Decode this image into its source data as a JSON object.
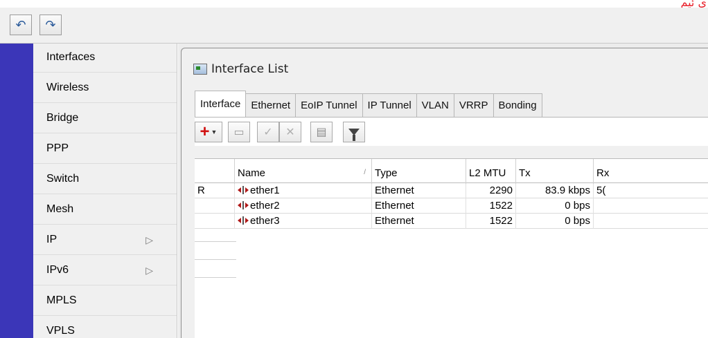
{
  "corner_text": "ى ئيم",
  "toolbar_top": {
    "undo_icon": "undo-icon",
    "redo_icon": "redo-icon"
  },
  "sidebar": {
    "items": [
      {
        "label": "Interfaces",
        "has_submenu": false
      },
      {
        "label": "Wireless",
        "has_submenu": false
      },
      {
        "label": "Bridge",
        "has_submenu": false
      },
      {
        "label": "PPP",
        "has_submenu": false
      },
      {
        "label": "Switch",
        "has_submenu": false
      },
      {
        "label": "Mesh",
        "has_submenu": false
      },
      {
        "label": "IP",
        "has_submenu": true
      },
      {
        "label": "IPv6",
        "has_submenu": true
      },
      {
        "label": "MPLS",
        "has_submenu": false
      },
      {
        "label": "VPLS",
        "has_submenu": false
      }
    ],
    "submenu_arrow": "▷"
  },
  "window": {
    "title": "Interface List",
    "tabs": [
      "Interface",
      "Ethernet",
      "EoIP Tunnel",
      "IP Tunnel",
      "VLAN",
      "VRRP",
      "Bonding"
    ],
    "active_tab": "Interface"
  },
  "table": {
    "columns": [
      "",
      "Name",
      "Type",
      "L2 MTU",
      "Tx",
      "Rx"
    ],
    "sort_indicator": "/",
    "rows": [
      {
        "flag": "R",
        "name": "ether1",
        "type": "Ethernet",
        "l2mtu": "2290",
        "tx": "83.9 kbps",
        "rx": "5("
      },
      {
        "flag": "",
        "name": "ether2",
        "type": "Ethernet",
        "l2mtu": "1522",
        "tx": "0 bps",
        "rx": ""
      },
      {
        "flag": "",
        "name": "ether3",
        "type": "Ethernet",
        "l2mtu": "1522",
        "tx": "0 bps",
        "rx": ""
      }
    ]
  },
  "colors": {
    "sidebar_strip": "#3b36b8",
    "add_icon": "#d01010",
    "corner_text": "#e8202a"
  }
}
